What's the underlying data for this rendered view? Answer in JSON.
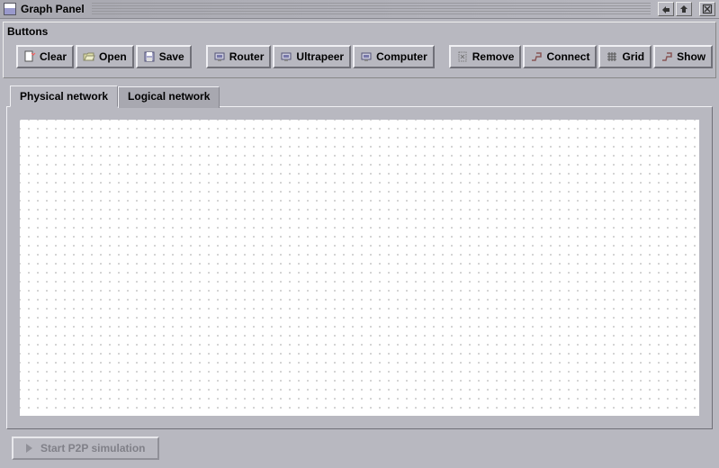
{
  "window": {
    "title": "Graph Panel",
    "buttons_panel_label": "Buttons"
  },
  "toolbar": {
    "group1": {
      "clear": "Clear",
      "open": "Open",
      "save": "Save"
    },
    "group2": {
      "router": "Router",
      "ultrapeer": "Ultrapeer",
      "computer": "Computer"
    },
    "group3": {
      "remove": "Remove",
      "connect": "Connect",
      "grid": "Grid",
      "show": "Show"
    }
  },
  "tabs": {
    "physical": "Physical network",
    "logical": "Logical network",
    "active": "physical"
  },
  "footer": {
    "start_simulation": "Start P2P simulation"
  }
}
